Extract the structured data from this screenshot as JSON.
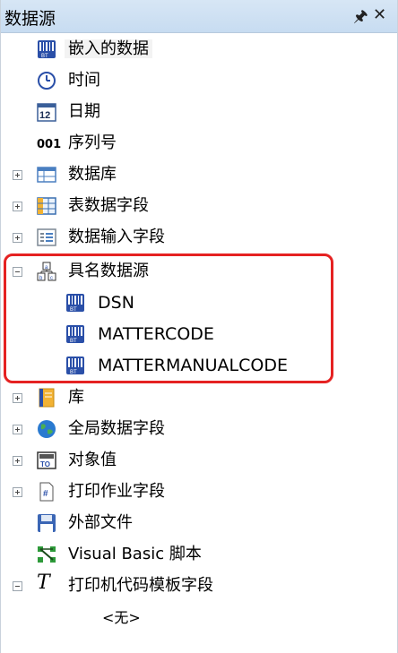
{
  "panel": {
    "title": "数据源",
    "pin_icon": "pin-icon",
    "close_icon": "close-icon"
  },
  "tree": {
    "embedded": "嵌入的数据",
    "time": "时间",
    "date": "日期",
    "date_icon_number": "12",
    "serial": "序列号",
    "serial_icon_text": "001",
    "database": "数据库",
    "table_fields": "表数据字段",
    "data_input_fields": "数据输入字段",
    "named_sources": "具名数据源",
    "named_children": [
      "DSN",
      "MATTERCODE",
      "MATTERMANUALCODE"
    ],
    "library": "库",
    "global_fields": "全局数据字段",
    "object_value": "对象值",
    "print_job_fields": "打印作业字段",
    "external_file": "外部文件",
    "vbscript": "Visual Basic 脚本",
    "print_code_template": "打印机代码模板字段",
    "none_placeholder": "<无>"
  },
  "colors": {
    "highlight": "#e52222",
    "titlebar": "#c7dcf1"
  }
}
